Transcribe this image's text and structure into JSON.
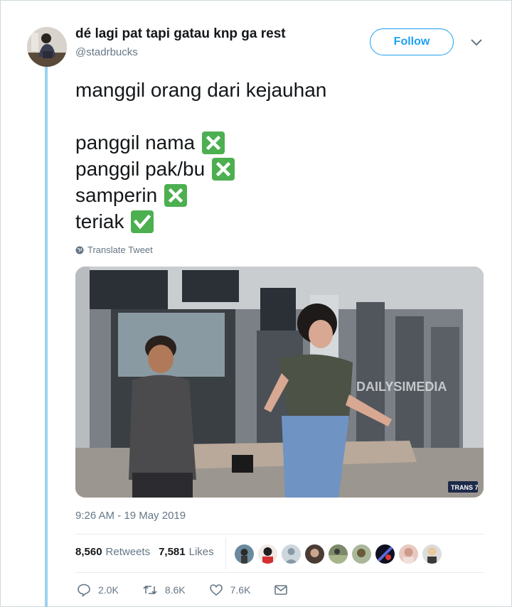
{
  "author": {
    "display_name": "dé lagi pat tapi gatau knp ga rest",
    "handle": "@stadrbucks",
    "avatar_icon": "user-photo"
  },
  "follow_label": "Follow",
  "tweet": {
    "lines": [
      {
        "text": "manggil orang dari kejauhan",
        "emoji": ""
      },
      {
        "text": "panggil nama",
        "emoji": "cross-mark"
      },
      {
        "text": "panggil pak/bu",
        "emoji": "cross-mark"
      },
      {
        "text": "samperin",
        "emoji": "cross-mark"
      },
      {
        "text": "teriak",
        "emoji": "check-mark"
      }
    ]
  },
  "translate_label": "Translate Tweet",
  "media": {
    "watermark": "DAILYSIMEDIA",
    "channel_logo": "TRANS 7"
  },
  "timestamp": "9:26 AM - 19 May 2019",
  "stats": {
    "retweets_count": "8,560",
    "retweets_label": "Retweets",
    "likes_count": "7,581",
    "likes_label": "Likes"
  },
  "actions": {
    "replies": "2.0K",
    "retweets": "8.6K",
    "likes": "7.6K"
  },
  "colors": {
    "brand": "#1da1f2",
    "thread_line": "#9bd2ef",
    "emoji_green": "#4caf50",
    "muted_text": "#657786"
  }
}
